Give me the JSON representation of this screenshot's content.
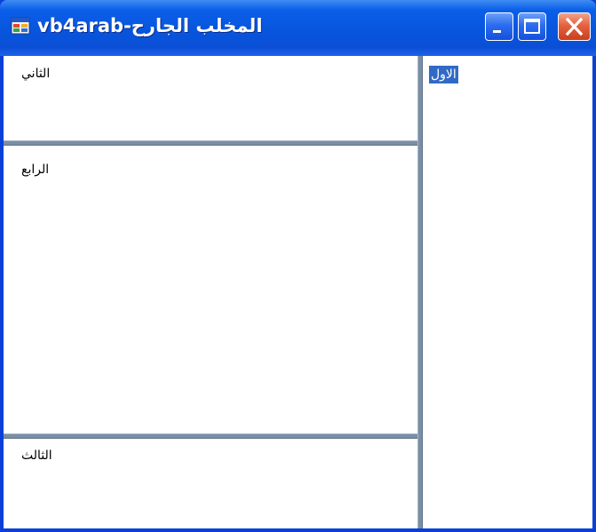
{
  "window": {
    "title": "vb4arab-المخلب الجارح",
    "icon": "app-form-icon",
    "controls": {
      "minimize": "minimize-icon",
      "maximize": "maximize-icon",
      "close": "close-icon"
    }
  },
  "panels": {
    "first": "الاول",
    "second": "الثاني",
    "third": "الثالث",
    "fourth": "الرابع"
  },
  "colors": {
    "titlebar": "#0a5ee9",
    "splitter": "#7a8fa6",
    "selection": "#316ac5",
    "close_button": "#e5623f"
  }
}
